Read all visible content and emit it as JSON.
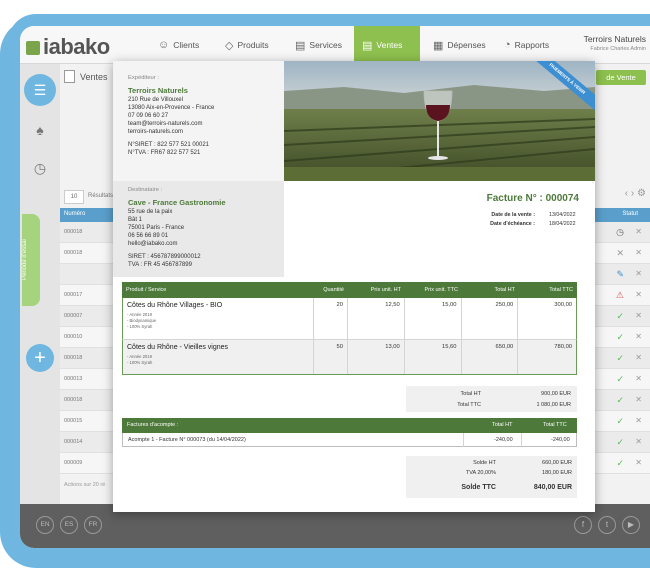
{
  "app": {
    "logo_text": "iabako",
    "user_name": "Terroirs Naturels",
    "user_sub": "Fabrice Charles Admin"
  },
  "nav": {
    "items": [
      {
        "label": "Clients",
        "icon": "person-icon"
      },
      {
        "label": "Produits",
        "icon": "tag-icon"
      },
      {
        "label": "Services",
        "icon": "briefcase-icon"
      },
      {
        "label": "Ventes",
        "icon": "invoice-icon",
        "active": true
      },
      {
        "label": "Dépenses",
        "icon": "ledger-icon"
      },
      {
        "label": "Rapports",
        "icon": "pie-chart-icon"
      }
    ]
  },
  "rail": {
    "tab_label": "Période d'essai"
  },
  "list": {
    "title": "Ventes",
    "new_button": "de Vente",
    "page_size": "10",
    "results_label": "Résultats",
    "col_number": "Numéro",
    "col_status": "Statut",
    "rows": [
      {
        "num": "000018",
        "status": "clock"
      },
      {
        "num": "000018",
        "status": "x"
      },
      {
        "num": "",
        "status": "edit"
      },
      {
        "num": "000017",
        "status": "alert"
      },
      {
        "num": "000007",
        "status": "check"
      },
      {
        "num": "000010",
        "status": "check"
      },
      {
        "num": "000018",
        "status": "check"
      },
      {
        "num": "000013",
        "status": "check"
      },
      {
        "num": "000018",
        "status": "check"
      },
      {
        "num": "000015",
        "status": "check"
      },
      {
        "num": "000014",
        "status": "check"
      },
      {
        "num": "000009",
        "status": "check"
      }
    ],
    "footer": "Actions sur 20 ré"
  },
  "footer": {
    "langs": [
      "EN",
      "ES",
      "FR"
    ],
    "social": [
      "facebook-icon",
      "twitter-icon",
      "youtube-icon"
    ]
  },
  "invoice": {
    "ribbon": "PAIEMENTS À VENIR",
    "sender": {
      "label": "Expéditeur :",
      "name": "Terroirs Naturels",
      "lines": [
        "210 Rue de Villouxel",
        "13080 Aix-en-Provence - France",
        "07 09 06 60 27",
        "team@terroirs-naturels.com",
        "terroirs-naturels.com"
      ],
      "ids": [
        "N°SIRET : 822 577 521 00021",
        "N°TVA : FR67 822 577 521"
      ]
    },
    "recipient": {
      "label": "Destinataire :",
      "name": "Cave - France Gastronomie",
      "lines": [
        "55 rue de la paix",
        "Bât 1",
        "75001 Paris - France",
        "06 56 66 89 01",
        "hello@iabako.com"
      ],
      "ids": [
        "SIRET : 456787899000012",
        "TVA : FR 45 456787899"
      ]
    },
    "title": "Facture N° : 000074",
    "date_label": "Date de la vente :",
    "date_value": "13/04/2022",
    "due_label": "Date d'échéance :",
    "due_value": "18/04/2022",
    "table_headers": [
      "Produit / Service",
      "Quantité",
      "Prix unit. HT",
      "Prix unit. TTC",
      "Total HT",
      "Total TTC"
    ],
    "items": [
      {
        "name": "Côtes du Rhône Villages - BIO",
        "details": [
          "- Année 2019",
          "- Biodynamique",
          "- 100% Syrah"
        ],
        "qty": "20",
        "pu_ht": "12,50",
        "pu_ttc": "15,00",
        "total_ht": "250,00",
        "total_ttc": "300,00"
      },
      {
        "name": "Côtes du Rhône - Vieilles vignes",
        "details": [
          "- Année 2019",
          "- 100% Syrah"
        ],
        "qty": "50",
        "pu_ht": "13,00",
        "pu_ttc": "15,60",
        "total_ht": "650,00",
        "total_ttc": "780,00"
      }
    ],
    "totals": {
      "ht_label": "Total HT",
      "ht_value": "900,00 EUR",
      "ttc_label": "Total TTC",
      "ttc_value": "1 080,00 EUR"
    },
    "acompte": {
      "header": "Factures d'acompte :",
      "col_ht": "Total HT",
      "col_ttc": "Total TTC",
      "row_label": "Acompte 1 - Facture N° 000073 (du 14/04/2022)",
      "row_ht": "-240,00",
      "row_ttc": "-240,00"
    },
    "final": {
      "solde_ht_label": "Solde HT",
      "solde_ht_value": "660,00 EUR",
      "tva_label": "TVA 20,00%",
      "tva_value": "180,00 EUR",
      "solde_ttc_label": "Solde TTC",
      "solde_ttc_value": "840,00 EUR"
    }
  }
}
